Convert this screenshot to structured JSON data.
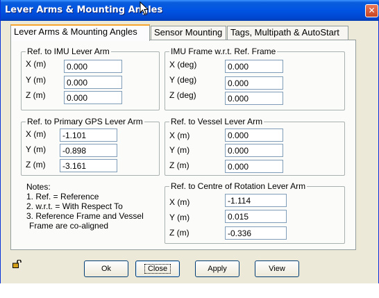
{
  "window": {
    "title": "Lever Arms & Mounting Angles",
    "close_glyph": "✕"
  },
  "tabs": [
    {
      "label": "Lever Arms & Mounting Angles",
      "active": true
    },
    {
      "label": "Sensor Mounting",
      "active": false
    },
    {
      "label": "Tags, Multipath & AutoStart",
      "active": false
    }
  ],
  "imu_lever_arm": {
    "title": "Ref. to IMU Lever Arm",
    "x_label": "X (m)",
    "x_value": "0.000",
    "y_label": "Y (m)",
    "y_value": "0.000",
    "z_label": "Z (m)",
    "z_value": "0.000"
  },
  "imu_frame": {
    "title": "IMU Frame w.r.t. Ref. Frame",
    "x_label": "X (deg)",
    "x_value": "0.000",
    "y_label": "Y (deg)",
    "y_value": "0.000",
    "z_label": "Z (deg)",
    "z_value": "0.000"
  },
  "gps_lever_arm": {
    "title": "Ref. to Primary GPS Lever Arm",
    "x_label": "X (m)",
    "x_value": "-1.101",
    "y_label": "Y (m)",
    "y_value": "-0.898",
    "z_label": "Z (m)",
    "z_value": "-3.161"
  },
  "vessel_lever_arm": {
    "title": "Ref. to Vessel Lever Arm",
    "x_label": "X (m)",
    "x_value": "0.000",
    "y_label": "Y (m)",
    "y_value": "0.000",
    "z_label": "Z (m)",
    "z_value": "0.000"
  },
  "rotation_lever_arm": {
    "title": "Ref. to Centre of Rotation Lever Arm",
    "x_label": "X (m)",
    "x_value": "-1.114",
    "y_label": "Y (m)",
    "y_value": "0.015",
    "z_label": "Z (m)",
    "z_value": "-0.336"
  },
  "notes": {
    "heading": "Notes:",
    "line1": "1. Ref. = Reference",
    "line2": "2. w.r.t. = With Respect To",
    "line3": "3. Reference Frame and Vessel",
    "line4": "Frame are co-aligned"
  },
  "buttons": {
    "ok": "Ok",
    "close": "Close",
    "apply": "Apply",
    "view": "View"
  },
  "icons": {
    "lock": "unlocked-padlock-icon",
    "cursor": "mouse-pointer-icon"
  }
}
